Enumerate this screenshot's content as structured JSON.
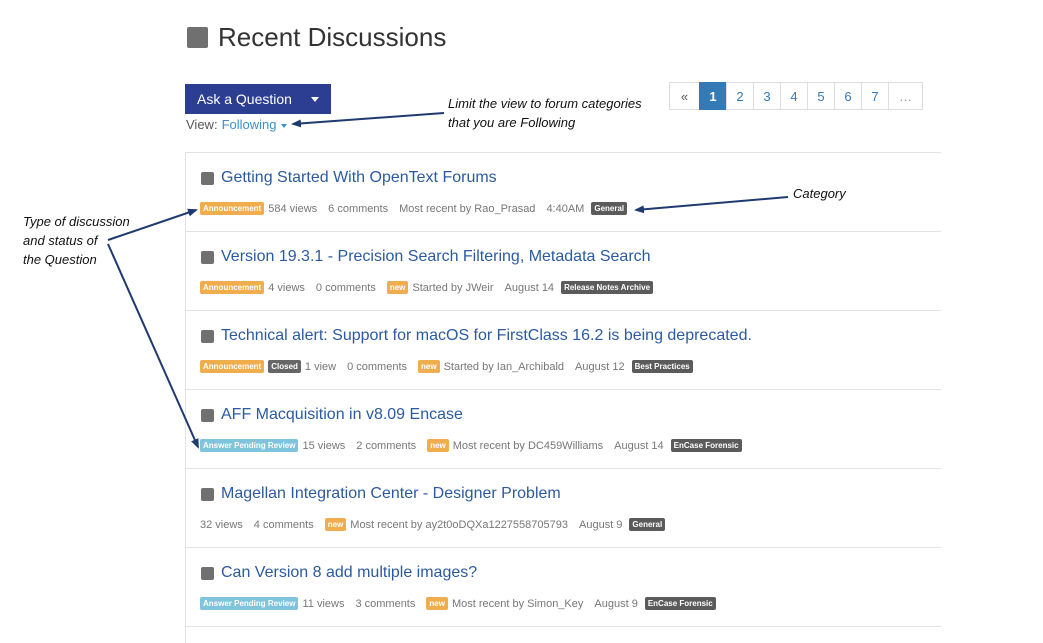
{
  "header": {
    "title": "Recent Discussions"
  },
  "toolbar": {
    "ask_label": "Ask a Question"
  },
  "view": {
    "label": "View:",
    "value": "Following"
  },
  "pagination": {
    "prev": "«",
    "pages": [
      "1",
      "2",
      "3",
      "4",
      "5",
      "6",
      "7"
    ],
    "ellipsis": "…",
    "active": "1"
  },
  "discussions": [
    {
      "title": "Getting Started With OpenText Forums",
      "type": "Announcement",
      "status": "",
      "views": "584 views",
      "comments": "6 comments",
      "new": "",
      "activity": "Most recent by Rao_Prasad",
      "time": "4:40AM",
      "category": "General"
    },
    {
      "title": "Version 19.3.1 - Precision Search Filtering, Metadata Search",
      "type": "Announcement",
      "status": "",
      "views": "4 views",
      "comments": "0 comments",
      "new": "new",
      "activity": "Started by JWeir",
      "time": "August 14",
      "category": "Release Notes Archive"
    },
    {
      "title": "Technical alert: Support for macOS for FirstClass 16.2 is being deprecated.",
      "type": "Announcement",
      "status": "Closed",
      "views": "1 view",
      "comments": "0 comments",
      "new": "new",
      "activity": "Started by Ian_Archibald",
      "time": "August 12",
      "category": "Best Practices"
    },
    {
      "title": "AFF Macquisition in v8.09 Encase",
      "type": "Answer Pending Review",
      "status": "",
      "views": "15 views",
      "comments": "2 comments",
      "new": "new",
      "activity": "Most recent by DC459Williams",
      "time": "August 14",
      "category": "EnCase Forensic"
    },
    {
      "title": "Magellan Integration Center - Designer Problem",
      "type": "",
      "status": "",
      "views": "32 views",
      "comments": "4 comments",
      "new": "new",
      "activity": "Most recent by ay2t0oDQXa1227558705793",
      "time": "August 9",
      "category": "General"
    },
    {
      "title": "Can Version 8 add multiple images?",
      "type": "Answer Pending Review",
      "status": "",
      "views": "11 views",
      "comments": "3 comments",
      "new": "new",
      "activity": "Most recent by Simon_Key",
      "time": "August 9",
      "category": "EnCase Forensic"
    }
  ],
  "annotations": {
    "view_note_1": "Limit the view to forum categories",
    "view_note_2": "that you are Following",
    "category_note": "Category",
    "type_note_1": "Type of discussion",
    "type_note_2": "and status of",
    "type_note_3": "the Question"
  },
  "colors": {
    "accent": "#2c3e91",
    "link": "#337ab7",
    "announcement": "#f0ad4e",
    "pending": "#7fc4dc",
    "category": "#5b5b5b",
    "arrow": "#1f3a6e"
  }
}
